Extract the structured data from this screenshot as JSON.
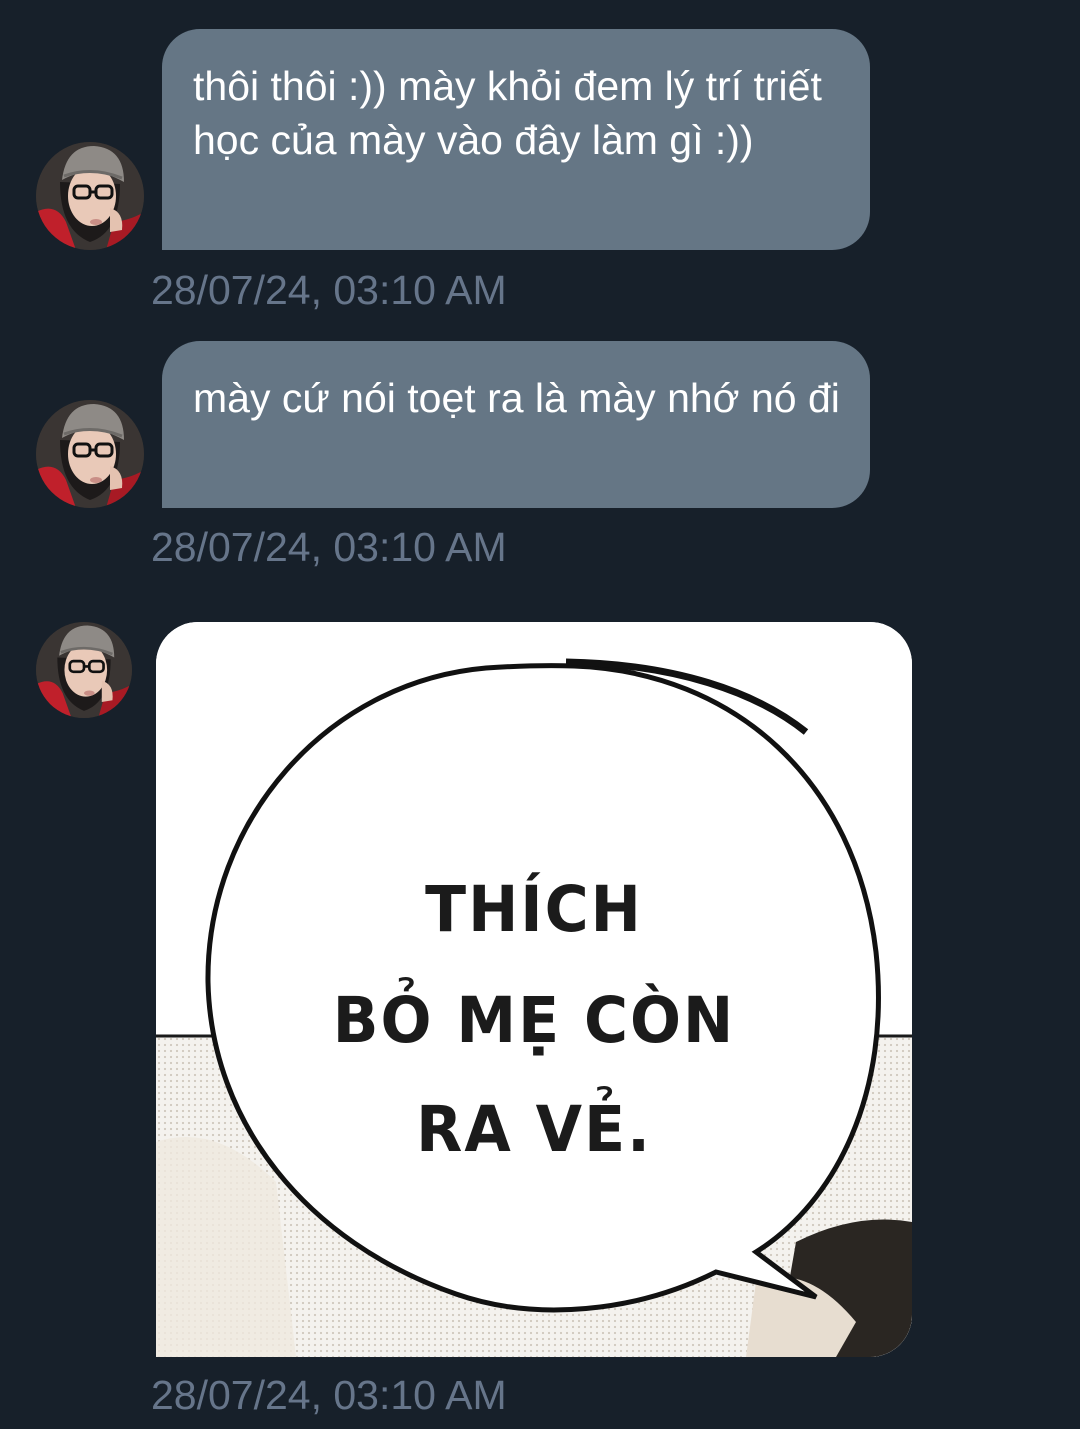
{
  "conversation": {
    "messages": [
      {
        "text": "thôi thôi :)) mày khỏi đem lý trí triết học của mày vào đây làm gì :))",
        "timestamp": "28/07/24, 03:10 AM"
      },
      {
        "text": "mày cứ nói toẹt ra là mày nhớ nó đi",
        "timestamp": "28/07/24, 03:10 AM"
      },
      {
        "type": "image",
        "image_text": [
          "THÍCH",
          "BỎ MẸ CÒN",
          "RA VẺ."
        ],
        "timestamp": "28/07/24, 03:10 AM"
      }
    ]
  },
  "colors": {
    "background": "#17202a",
    "bubble": "#657685",
    "bubble_text": "#ffffff",
    "timestamp": "#66758a"
  },
  "icons": {
    "avatar": "avatar-girl-glasses-beanie"
  }
}
